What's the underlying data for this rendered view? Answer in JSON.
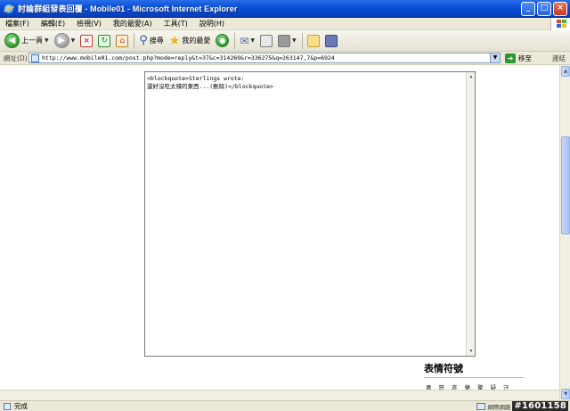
{
  "window": {
    "title": "討論群組發表回覆 - Mobile01 - Microsoft Internet Explorer",
    "minimize": "_",
    "maximize": "□",
    "close": "×"
  },
  "menu": {
    "items": [
      "檔案(F)",
      "編輯(E)",
      "檢視(V)",
      "我的最愛(A)",
      "工具(T)",
      "說明(H)"
    ]
  },
  "toolbar": {
    "back_label": "上一頁",
    "search_label": "搜尋",
    "favorites_label": "我的最愛"
  },
  "address": {
    "label": "網址(D)",
    "url": "http://www.mobile01.com/post.php?mode=reply&t=37&c=314269&r=336275&q=263147,7&p=6924",
    "go_label": "移至",
    "links_label": "連結"
  },
  "editor": {
    "lines": [
      "<blockquote>Sterlings wrote:",
      "還好沒吃太辣的東西...(刪除)</blockquote>"
    ]
  },
  "emoticons": {
    "title": "表情符號",
    "items": [
      "喜",
      "怒",
      "哀",
      "樂",
      "驚",
      "疑",
      "汗"
    ]
  },
  "status": {
    "text": "完成",
    "zone": "網際網路",
    "watermark": "#1601158"
  },
  "colors": {
    "titlebar": "#0a50d8",
    "chrome": "#ece9d8",
    "go_green": "#2c9a2c"
  }
}
